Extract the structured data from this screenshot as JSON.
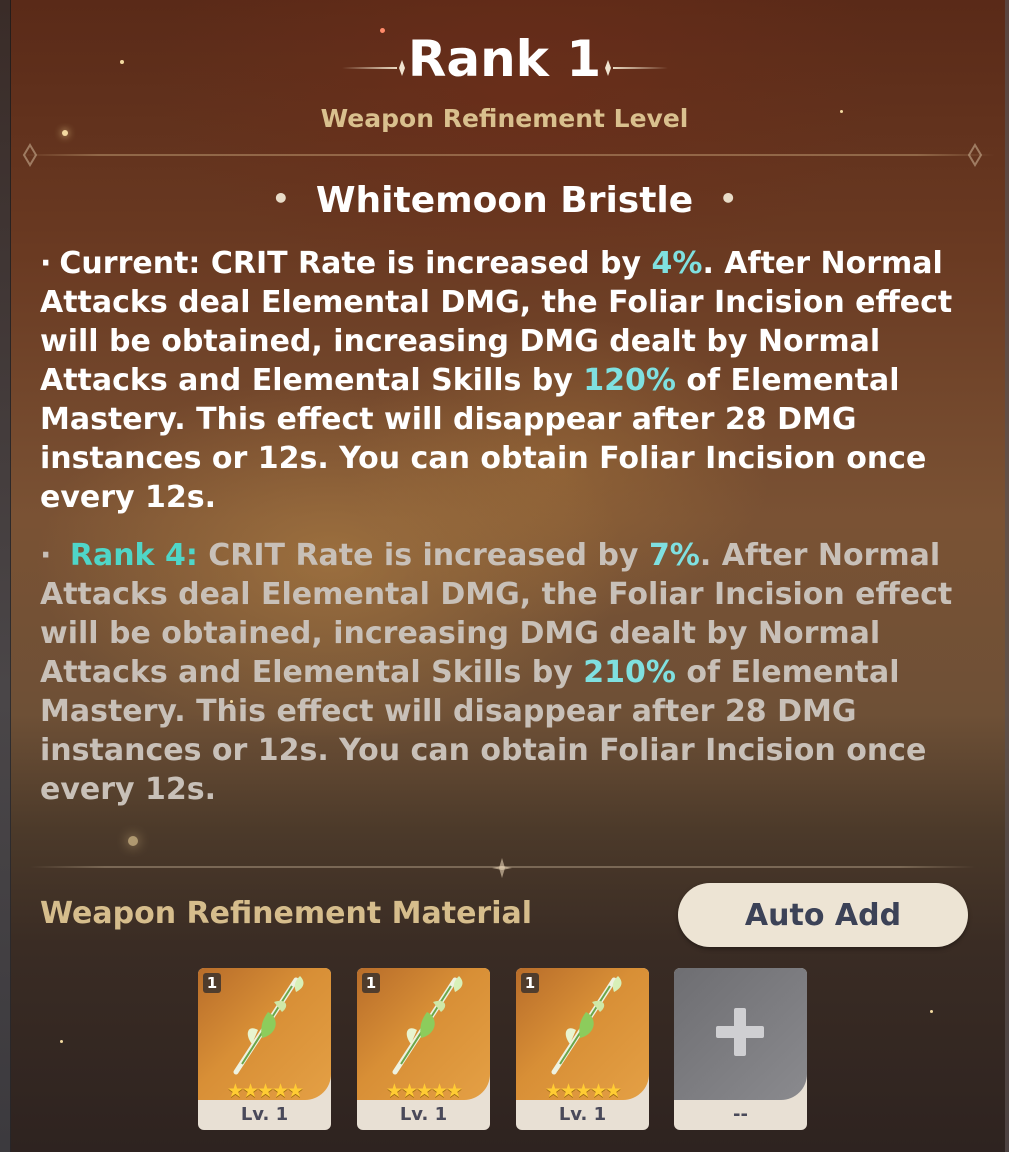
{
  "header": {
    "title": "Rank 1",
    "subtitle": "Weapon Refinement Level",
    "weapon_name": "Whitemoon Bristle"
  },
  "current": {
    "bullet": "·",
    "label": "Current:",
    "t1": " CRIT Rate is increased by ",
    "v1": "4%",
    "t2": ". After Normal Attacks deal Elemental DMG, the Foliar Incision effect will be obtained, increasing DMG dealt by Normal Attacks and Elemental Skills by ",
    "v2": "120%",
    "t3": " of Elemental Mastery. This effect will disappear after 28 DMG instances or 12s. You can obtain Foliar Incision once every 12s."
  },
  "next_rank": {
    "bullet": "·",
    "label": "Rank 4:",
    "t1": "  CRIT Rate is increased by ",
    "v1": "7%",
    "t2": ". After Normal Attacks deal Elemental DMG, the Foliar Incision effect will be obtained, increasing DMG dealt by Normal Attacks and Elemental Skills by ",
    "v2": "210%",
    "t3": " of Elemental Mastery. This effect will disappear after 28 DMG instances or 12s. You can obtain Foliar Incision once every 12s."
  },
  "materials": {
    "label": "Weapon Refinement Material",
    "auto_add_label": "Auto Add",
    "slots": [
      {
        "count": "1",
        "stars": "★★★★★",
        "level": "Lv. 1",
        "icon": "spear-icon"
      },
      {
        "count": "1",
        "stars": "★★★★★",
        "level": "Lv. 1",
        "icon": "spear-icon"
      },
      {
        "count": "1",
        "stars": "★★★★★",
        "level": "Lv. 1",
        "icon": "spear-icon"
      },
      {
        "level": "--",
        "icon": "plus-icon"
      }
    ]
  },
  "colors": {
    "highlight": "#7fe0e0",
    "rank_label": "#4fd6c8",
    "gold_text": "#d6bd8c",
    "button_bg": "#ede4d4"
  }
}
